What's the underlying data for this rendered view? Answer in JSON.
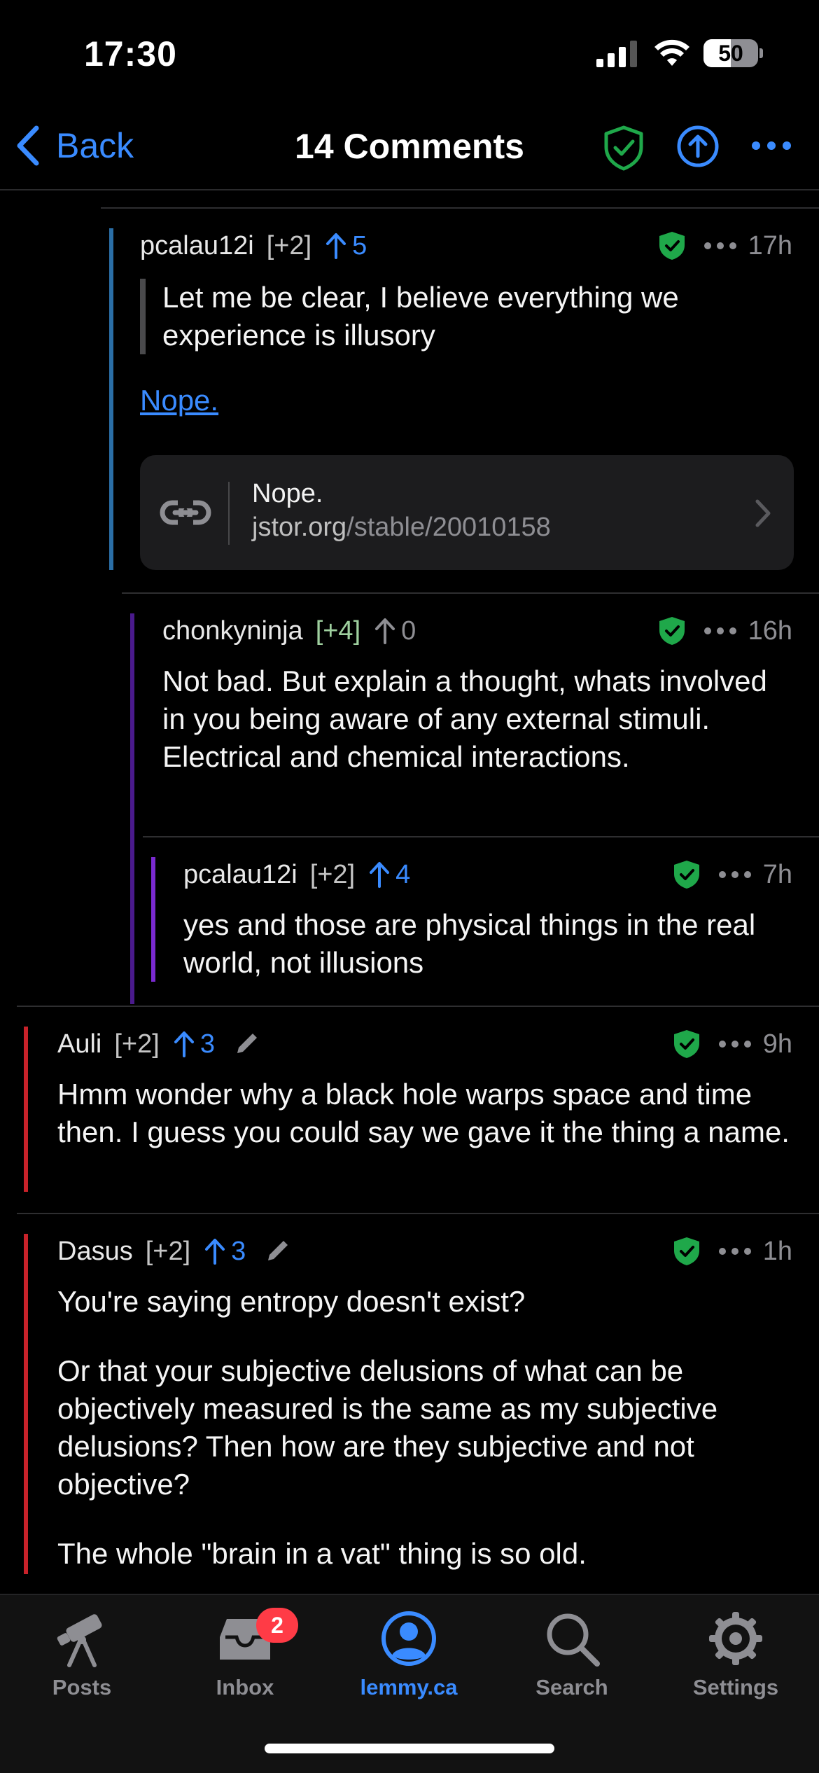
{
  "status_bar": {
    "time": "17:30",
    "battery_level": "50",
    "battery_fraction": 0.5,
    "icons": [
      "cellular-signal-icon",
      "wifi-icon",
      "battery-icon"
    ]
  },
  "nav": {
    "back_label": "Back",
    "title": "14 Comments",
    "icons": [
      "shield-check-icon",
      "arrow-up-circle-icon",
      "ellipsis-icon"
    ]
  },
  "colors": {
    "accent": "#3a8bff",
    "shield_green": "#1fa84a",
    "thread_blue": "#2a6ea6",
    "thread_purple": "#4a1a8c",
    "thread_violet": "#7a2ad0",
    "thread_red": "#c8222a",
    "badge_red": "#ff3b46"
  },
  "comments": [
    {
      "author": "pcalau12i",
      "score": "[+2]",
      "upvotes": "5",
      "time": "17h",
      "quote": "Let me be clear, I believe everything we experience is illusory",
      "link_text": "Nope.",
      "link_card": {
        "title": "Nope.",
        "domain": "jstor.org",
        "path": "/stable/20010158"
      }
    },
    {
      "author": "chonkyninja",
      "score": "[+4]",
      "upvotes": "0",
      "time": "16h",
      "body": "Not bad. But explain a thought, whats involved in you being aware of any external stimuli. Electrical and chemical interactions."
    },
    {
      "author": "pcalau12i",
      "score": "[+2]",
      "upvotes": "4",
      "time": "7h",
      "body": "yes and those are physical things in the real world, not illusions"
    },
    {
      "author": "Auli",
      "score": "[+2]",
      "upvotes": "3",
      "time": "9h",
      "body": "Hmm wonder why a black hole warps space and time then. I guess you could say we gave it the thing a name."
    },
    {
      "author": "Dasus",
      "score": "[+2]",
      "upvotes": "3",
      "time": "1h",
      "paragraphs": [
        "You're saying entropy doesn't exist?",
        "Or that your subjective delusions of what can be objectively measured is the same as my subjective delusions? Then how are they subjective and not objective?",
        "The whole \"brain in a vat\" thing is so old."
      ]
    }
  ],
  "tabbar": {
    "tabs": [
      {
        "label": "Posts",
        "icon": "telescope-icon"
      },
      {
        "label": "Inbox",
        "icon": "inbox-tray-icon",
        "badge": "2"
      },
      {
        "label": "lemmy.ca",
        "icon": "person-circle-icon",
        "active": true
      },
      {
        "label": "Search",
        "icon": "magnifying-glass-icon"
      },
      {
        "label": "Settings",
        "icon": "gear-icon"
      }
    ]
  }
}
